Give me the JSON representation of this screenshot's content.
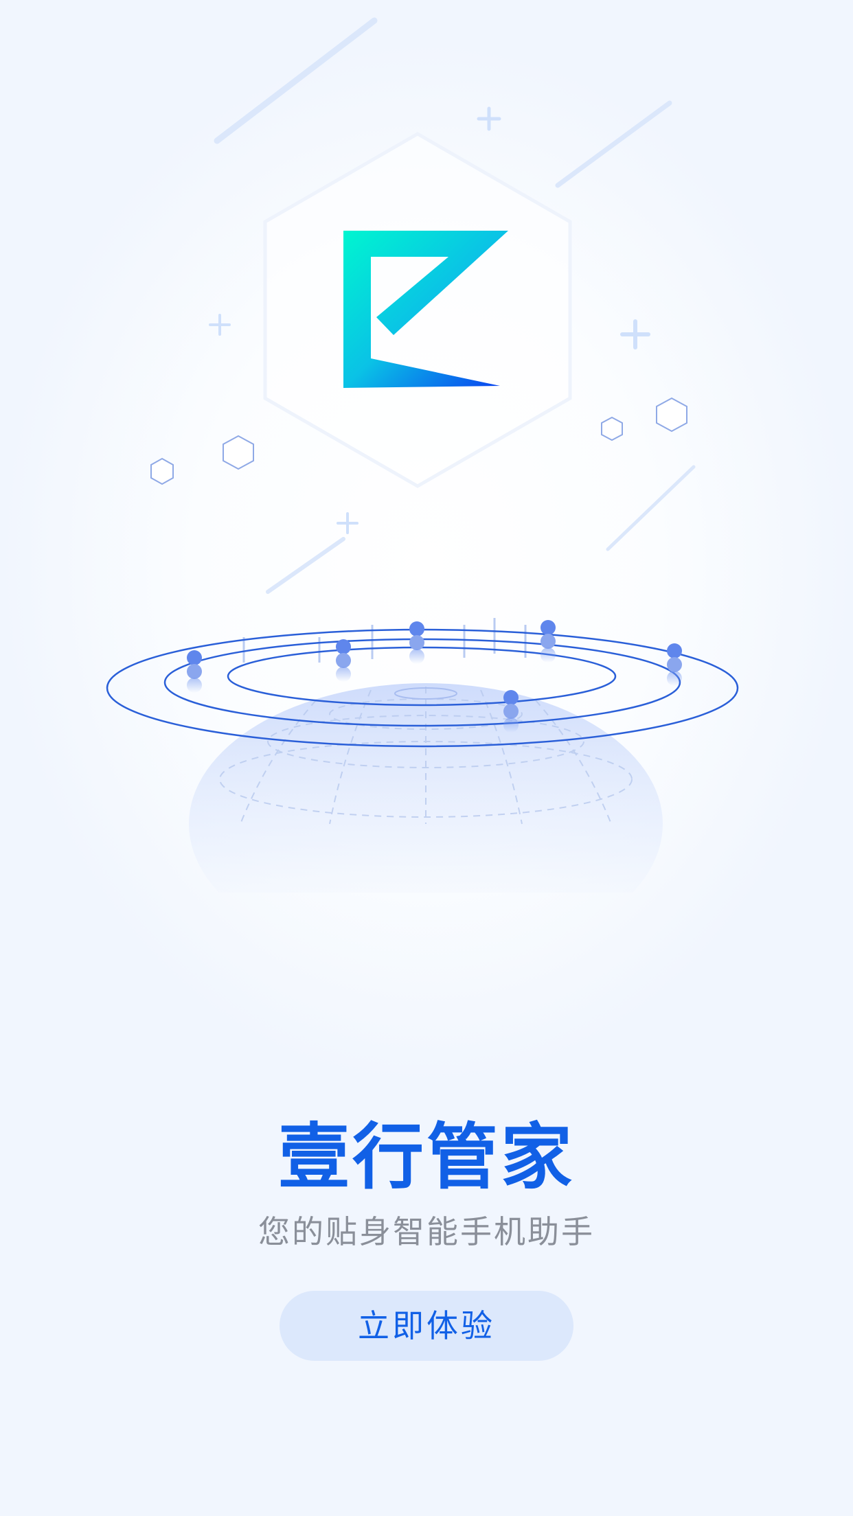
{
  "app": {
    "title": "壹行管家",
    "subtitle": "您的贴身智能手机助手",
    "start_button_label": "立即体验"
  },
  "colors": {
    "brand_blue": "#1160e6",
    "subtitle_gray": "#8a8f99",
    "button_bg": "#dce8fc",
    "logo_gradient_start": "#00f2d2",
    "logo_gradient_end": "#0a3df0",
    "orbit_blue": "#2a5fd8"
  },
  "icons": {
    "logo": "app-logo-e-mark",
    "illustration": "globe-orbit-illustration"
  }
}
